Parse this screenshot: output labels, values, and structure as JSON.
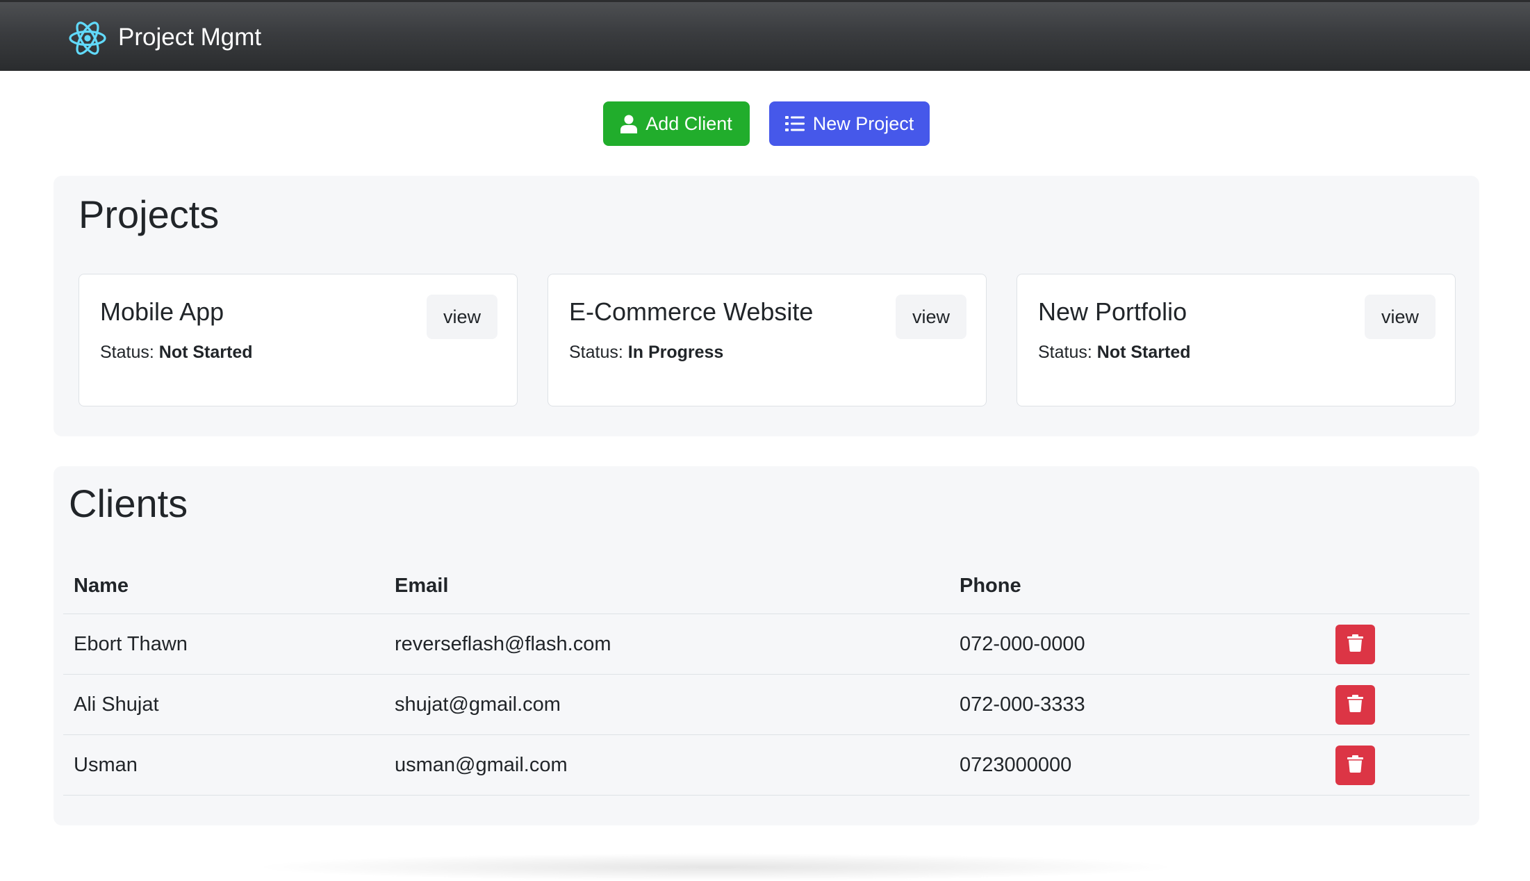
{
  "header": {
    "title": "Project Mgmt",
    "logo_icon": "react-atom-icon",
    "logo_color": "#61dafb"
  },
  "actions": {
    "add_client": {
      "label": "Add Client",
      "icon": "user-icon",
      "color": "#21ad2c"
    },
    "new_project": {
      "label": "New Project",
      "icon": "list-icon",
      "color": "#4658ea"
    }
  },
  "projects": {
    "title": "Projects",
    "status_label": "Status:",
    "view_label": "view",
    "items": [
      {
        "name": "Mobile App",
        "status": "Not Started"
      },
      {
        "name": "E-Commerce Website",
        "status": "In Progress"
      },
      {
        "name": "New Portfolio",
        "status": "Not Started"
      }
    ]
  },
  "clients": {
    "title": "Clients",
    "columns": [
      "Name",
      "Email",
      "Phone"
    ],
    "delete_color": "#dc3545",
    "rows": [
      {
        "name": "Ebort Thawn",
        "email": "reverseflash@flash.com",
        "phone": "072-000-0000"
      },
      {
        "name": "Ali Shujat",
        "email": "shujat@gmail.com",
        "phone": "072-000-3333"
      },
      {
        "name": "Usman",
        "email": "usman@gmail.com",
        "phone": "0723000000"
      }
    ]
  }
}
